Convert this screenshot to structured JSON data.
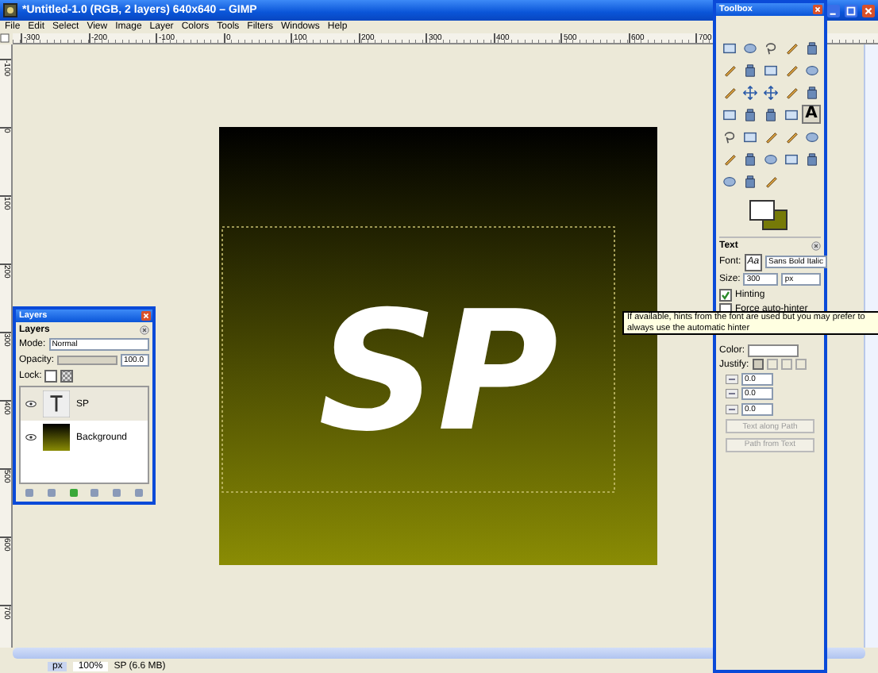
{
  "window": {
    "title": "*Untitled-1.0 (RGB, 2 layers) 640x640 – GIMP"
  },
  "menu": [
    "File",
    "Edit",
    "Select",
    "View",
    "Image",
    "Layer",
    "Colors",
    "Tools",
    "Filters",
    "Windows",
    "Help"
  ],
  "hruler": [
    "-300",
    "-200",
    "-100",
    "0",
    "100",
    "200",
    "300",
    "400",
    "500",
    "600",
    "700"
  ],
  "vruler": [
    "-100",
    "0",
    "100",
    "200",
    "300",
    "400",
    "500",
    "600",
    "700"
  ],
  "canvas": {
    "text": "SP"
  },
  "status": {
    "unit": "px",
    "zoom": "100%",
    "info": "SP (6.6 MB)"
  },
  "toolbox": {
    "title": "Toolbox",
    "tools": [
      {
        "kind": "frame",
        "selected": false
      },
      {
        "kind": "blob",
        "selected": false
      },
      {
        "kind": "lasso",
        "selected": false
      },
      {
        "kind": "pen",
        "selected": false
      },
      {
        "kind": "tube",
        "selected": false
      },
      {
        "kind": "pen",
        "selected": false
      },
      {
        "kind": "tube",
        "selected": false
      },
      {
        "kind": "frame",
        "selected": false
      },
      {
        "kind": "pen",
        "selected": false
      },
      {
        "kind": "blob",
        "selected": false
      },
      {
        "kind": "pen",
        "selected": false
      },
      {
        "kind": "arrow",
        "selected": false
      },
      {
        "kind": "arrow",
        "selected": false
      },
      {
        "kind": "pen",
        "selected": false
      },
      {
        "kind": "tube",
        "selected": false
      },
      {
        "kind": "frame",
        "selected": false
      },
      {
        "kind": "tube",
        "selected": false
      },
      {
        "kind": "tube",
        "selected": false
      },
      {
        "kind": "frame",
        "selected": false
      },
      {
        "kind": "text",
        "label": "A",
        "selected": true
      },
      {
        "kind": "lasso",
        "selected": false
      },
      {
        "kind": "frame",
        "selected": false
      },
      {
        "kind": "pen",
        "selected": false
      },
      {
        "kind": "pen",
        "selected": false
      },
      {
        "kind": "blob",
        "selected": false
      },
      {
        "kind": "pen",
        "selected": false
      },
      {
        "kind": "tube",
        "selected": false
      },
      {
        "kind": "blob",
        "selected": false
      },
      {
        "kind": "frame",
        "selected": false
      },
      {
        "kind": "tube",
        "selected": false
      },
      {
        "kind": "blob",
        "selected": false
      },
      {
        "kind": "tube",
        "selected": false
      },
      {
        "kind": "pen",
        "selected": false
      }
    ]
  },
  "tool_options": {
    "title": "Text",
    "font_label": "Font:",
    "font_preview": "Aa",
    "font": "Sans Bold Italic",
    "size_label": "Size:",
    "size": "300",
    "unit": "px",
    "options": [
      {
        "label": "Hinting",
        "checked": true
      },
      {
        "label": "Force auto-hinter",
        "checked": false
      }
    ],
    "color_label": "Color:",
    "justify_label": "Justify:",
    "justify": [
      {
        "selected": true
      },
      {
        "selected": false
      },
      {
        "selected": false
      },
      {
        "selected": false
      }
    ],
    "spacings": [
      "0.0",
      "0.0",
      "0.0"
    ],
    "buttons": [
      {
        "label": "Text along Path",
        "disabled": true
      },
      {
        "label": "Path from Text",
        "disabled": true
      }
    ]
  },
  "tooltip": "If available, hints from the font are used but you may prefer to always use the automatic hinter",
  "layers": {
    "title": "Layers",
    "header": "Layers",
    "mode_label": "Mode:",
    "mode": "Normal",
    "opacity_label": "Opacity:",
    "opacity": "100.0",
    "level": 1.0,
    "lock_label": "Lock:",
    "locks": [
      {
        "checked": false
      },
      {
        "checked": false
      }
    ],
    "items": [
      {
        "name": "SP",
        "kind": "text",
        "visible": true,
        "selected": true
      },
      {
        "name": "Background",
        "kind": "image",
        "visible": true,
        "selected": false
      }
    ]
  }
}
